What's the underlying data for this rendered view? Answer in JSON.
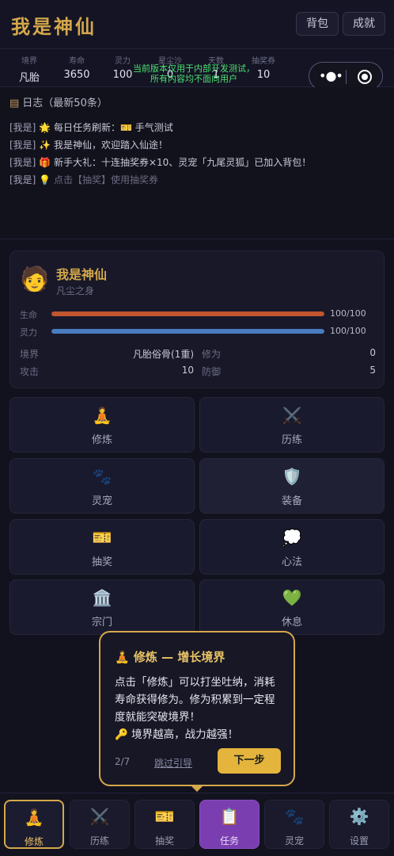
{
  "header": {
    "title": "我是神仙",
    "btn_bag": "背包",
    "btn_achievement": "成就"
  },
  "stats": [
    {
      "label": "境界",
      "value": "凡胎"
    },
    {
      "label": "寿命",
      "value": "3650"
    },
    {
      "label": "灵力",
      "value": "100"
    },
    {
      "label": "星尘沙",
      "value": "0"
    },
    {
      "label": "天数",
      "value": "1"
    },
    {
      "label": "抽奖券",
      "value": "10"
    }
  ],
  "notice": {
    "line1": "当前版本仅用于内部开发测试，",
    "line2": "所有内容均不面向用户"
  },
  "capsule": {
    "more_icon": "more-dots-icon",
    "close_icon": "target-circle-icon"
  },
  "log": {
    "title": "日志（最新50条）",
    "icon": "scroll-icon",
    "lines": [
      {
        "tag": "[我是]",
        "icon": "🌟",
        "text": " 每日任务刷新：🎫 手气测试"
      },
      {
        "tag": "[我是]",
        "icon": "✨",
        "text": " 我是神仙，欢迎踏入仙途！"
      },
      {
        "tag": "[我是]",
        "icon": "🎁",
        "text": " 新手大礼：十连抽奖券×10、灵宠「九尾灵狐」已加入背包！"
      },
      {
        "tag": "[我是]",
        "icon": "💡",
        "text": " 点击【抽奖】使用抽奖券"
      }
    ]
  },
  "character": {
    "avatar_icon": "🧑",
    "name": "我是神仙",
    "subtitle": "凡尘之身",
    "hp_label": "生命",
    "hp_value": "100/100",
    "hp_fraction": 1.0,
    "hp_color": "#c0552f",
    "mp_label": "灵力",
    "mp_value": "100/100",
    "mp_fraction": 1.0,
    "mp_color": "#4a7cc0",
    "realm_label": "境界",
    "realm_value": "凡胎俗骨(1重)",
    "cultivation_label": "修为",
    "cultivation_value": "0",
    "attack_label": "攻击",
    "attack_value": "10",
    "defense_label": "防御",
    "defense_value": "5"
  },
  "actions": [
    {
      "icon": "🧘",
      "label": "修炼"
    },
    {
      "icon": "⚔️",
      "label": "历练"
    },
    {
      "icon": "🐾",
      "label": "灵宠"
    },
    {
      "icon": "🛡️",
      "label": "装备"
    },
    {
      "icon": "🎫",
      "label": "抽奖"
    },
    {
      "icon": "💭",
      "label": "心法"
    },
    {
      "icon": "🏛️",
      "label": "宗门"
    },
    {
      "icon": "💚",
      "label": "休息"
    }
  ],
  "guide": {
    "title_icon": "🧘",
    "title": "修炼 — 增长境界",
    "body1": "点击「修炼」可以打坐吐纳，消耗寿命获得修为。修为积累到一定程度就能突破境界！",
    "body2": "🔑 境界越高，战力越强！",
    "step": "2/7",
    "skip": "跳过引导",
    "next": "下一步"
  },
  "nav": [
    {
      "icon": "🧘",
      "label": "修炼"
    },
    {
      "icon": "⚔️",
      "label": "历练"
    },
    {
      "icon": "🎫",
      "label": "抽奖"
    },
    {
      "icon": "📋",
      "label": "任务"
    },
    {
      "icon": "🐾",
      "label": "灵宠"
    },
    {
      "icon": "⚙️",
      "label": "设置"
    }
  ],
  "accent": "#d4a84b"
}
